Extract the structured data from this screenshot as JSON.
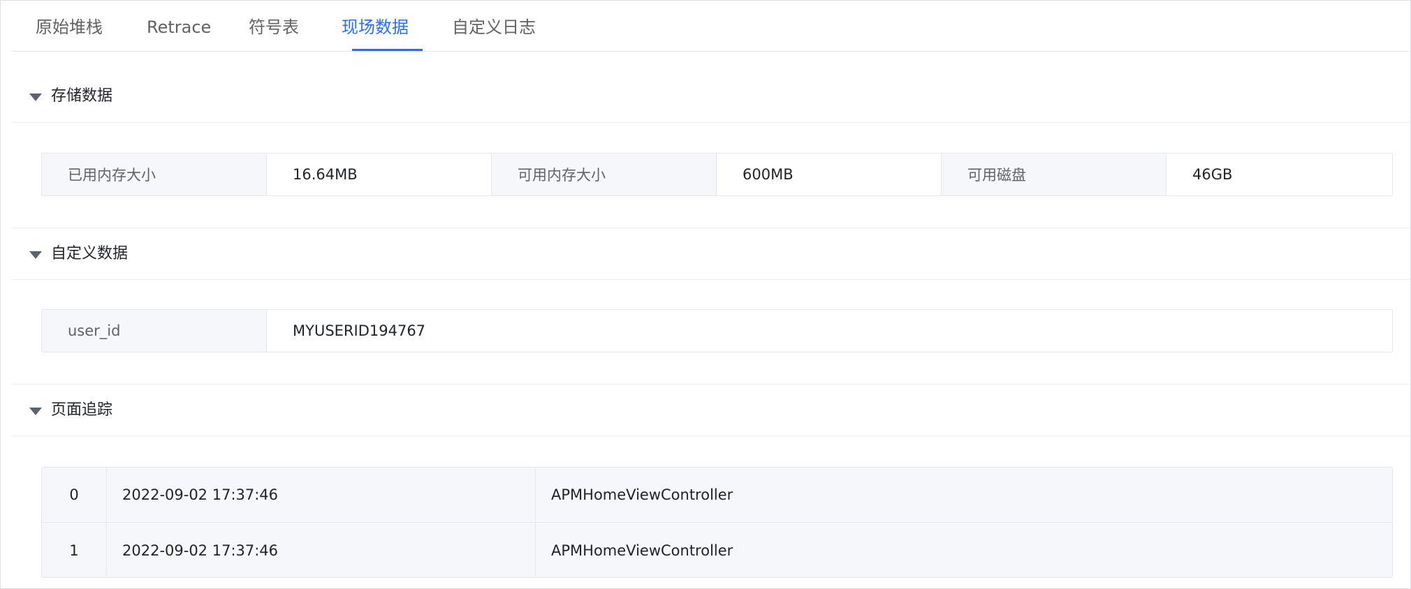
{
  "tabs": [
    {
      "label": "原始堆栈",
      "active": false
    },
    {
      "label": "Retrace",
      "active": false
    },
    {
      "label": "符号表",
      "active": false
    },
    {
      "label": "现场数据",
      "active": true
    },
    {
      "label": "自定义日志",
      "active": false
    }
  ],
  "sections": {
    "storage": {
      "title": "存储数据",
      "pairs": [
        {
          "label": "已用内存大小",
          "value": "16.64MB"
        },
        {
          "label": "可用内存大小",
          "value": "600MB"
        },
        {
          "label": "可用磁盘",
          "value": "46GB"
        }
      ]
    },
    "custom": {
      "title": "自定义数据",
      "pairs": [
        {
          "label": "user_id",
          "value": "MYUSERID194767"
        }
      ]
    },
    "page_trace": {
      "title": "页面追踪",
      "rows": [
        {
          "index": "0",
          "time": "2022-09-02 17:37:46",
          "page": "APMHomeViewController"
        },
        {
          "index": "1",
          "time": "2022-09-02 17:37:46",
          "page": "APMHomeViewController"
        }
      ]
    }
  },
  "colors": {
    "accent": "#2b6ef6",
    "label_bg": "#f5f7fa",
    "border": "#e4e7ed"
  }
}
